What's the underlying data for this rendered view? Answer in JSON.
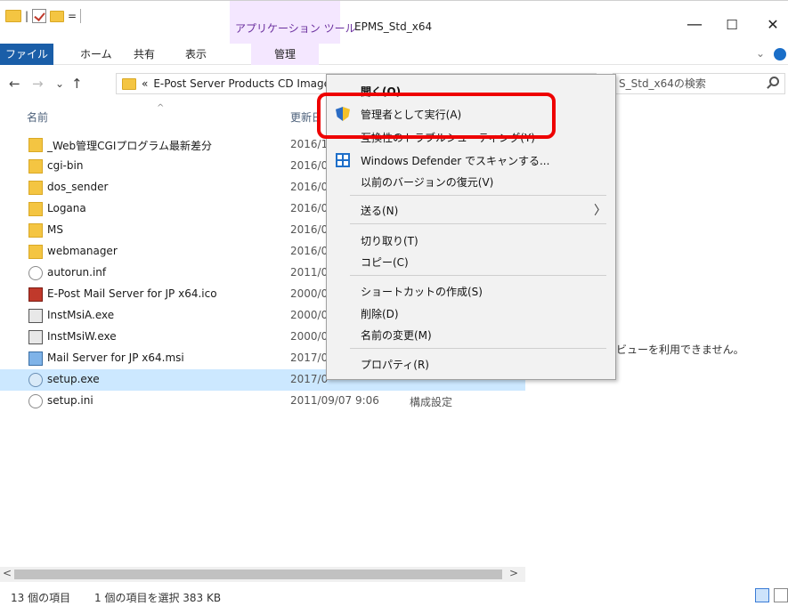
{
  "titlebar": {
    "qat_separator": "|",
    "qat_dropdown": "=",
    "contextual_tab_group": "アプリケーション ツール",
    "window_title": "EPMS_Std_x64",
    "minimize": "—",
    "maximize": "☐",
    "close": "✕"
  },
  "ribbon": {
    "tabs": [
      "ファイル",
      "ホーム",
      "共有",
      "表示",
      "管理"
    ],
    "expand_chevron": "⌄"
  },
  "nav": {
    "back": "←",
    "forward": "→",
    "recent": "⌄",
    "up": "↑",
    "address_prefix": "«",
    "address": "E-Post Server Products CD Image",
    "search_placeholder": "S_Std_x64の検索"
  },
  "list": {
    "columns": {
      "name": "名前",
      "date": "更新日",
      "sort_indicator": "^"
    },
    "rows": [
      {
        "icon": "folder-icon",
        "name": "_Web管理CGIプログラム最新差分",
        "date": "2016/1",
        "type": ""
      },
      {
        "icon": "folder-icon",
        "name": "cgi-bin",
        "date": "2016/0",
        "type": ""
      },
      {
        "icon": "folder-icon",
        "name": "dos_sender",
        "date": "2016/0",
        "type": ""
      },
      {
        "icon": "folder-icon",
        "name": "Logana",
        "date": "2016/0",
        "type": ""
      },
      {
        "icon": "folder-icon",
        "name": "MS",
        "date": "2016/0",
        "type": ""
      },
      {
        "icon": "folder-icon",
        "name": "webmanager",
        "date": "2016/0",
        "type": ""
      },
      {
        "icon": "settings-file-icon",
        "name": "autorun.inf",
        "date": "2011/0",
        "type": ""
      },
      {
        "icon": "ico-file-icon",
        "name": "E-Post Mail Server for JP x64.ico",
        "date": "2000/0",
        "type": ""
      },
      {
        "icon": "exe-icon",
        "name": "InstMsiA.exe",
        "date": "2000/0",
        "type": ""
      },
      {
        "icon": "exe-icon",
        "name": "InstMsiW.exe",
        "date": "2000/0",
        "type": ""
      },
      {
        "icon": "msi-icon",
        "name": "Mail Server for JP x64.msi",
        "date": "2017/0",
        "type": ""
      },
      {
        "icon": "setup-icon",
        "name": "setup.exe",
        "date": "2017/0",
        "type": ""
      },
      {
        "icon": "settings-file-icon",
        "name": "setup.ini",
        "date": "2011/09/07 9:06",
        "type": "構成設定"
      }
    ]
  },
  "preview": {
    "message": "ビューを利用できません。"
  },
  "scrollbar": {
    "left": "<",
    "right": ">"
  },
  "status": {
    "item_count": "13 個の項目",
    "selection": "1 個の項目を選択  383 KB"
  },
  "context_menu": {
    "open": "開く(O)",
    "run_as_admin": "管理者として実行(A)",
    "troubleshoot_compat": "互換性のトラブルシューティング(Y)",
    "defender_scan": "Windows Defender でスキャンする...",
    "restore_previous": "以前のバージョンの復元(V)",
    "send_to": "送る(N)",
    "submenu_arrow": "〉",
    "cut": "切り取り(T)",
    "copy": "コピー(C)",
    "create_shortcut": "ショートカットの作成(S)",
    "delete": "削除(D)",
    "rename": "名前の変更(M)",
    "properties": "プロパティ(R)"
  },
  "colors": {
    "file_tab": "#1a5ea8",
    "contextual_tab": "#f4e7ff",
    "selection": "#cce8ff",
    "highlight_ring": "#ee0000"
  }
}
